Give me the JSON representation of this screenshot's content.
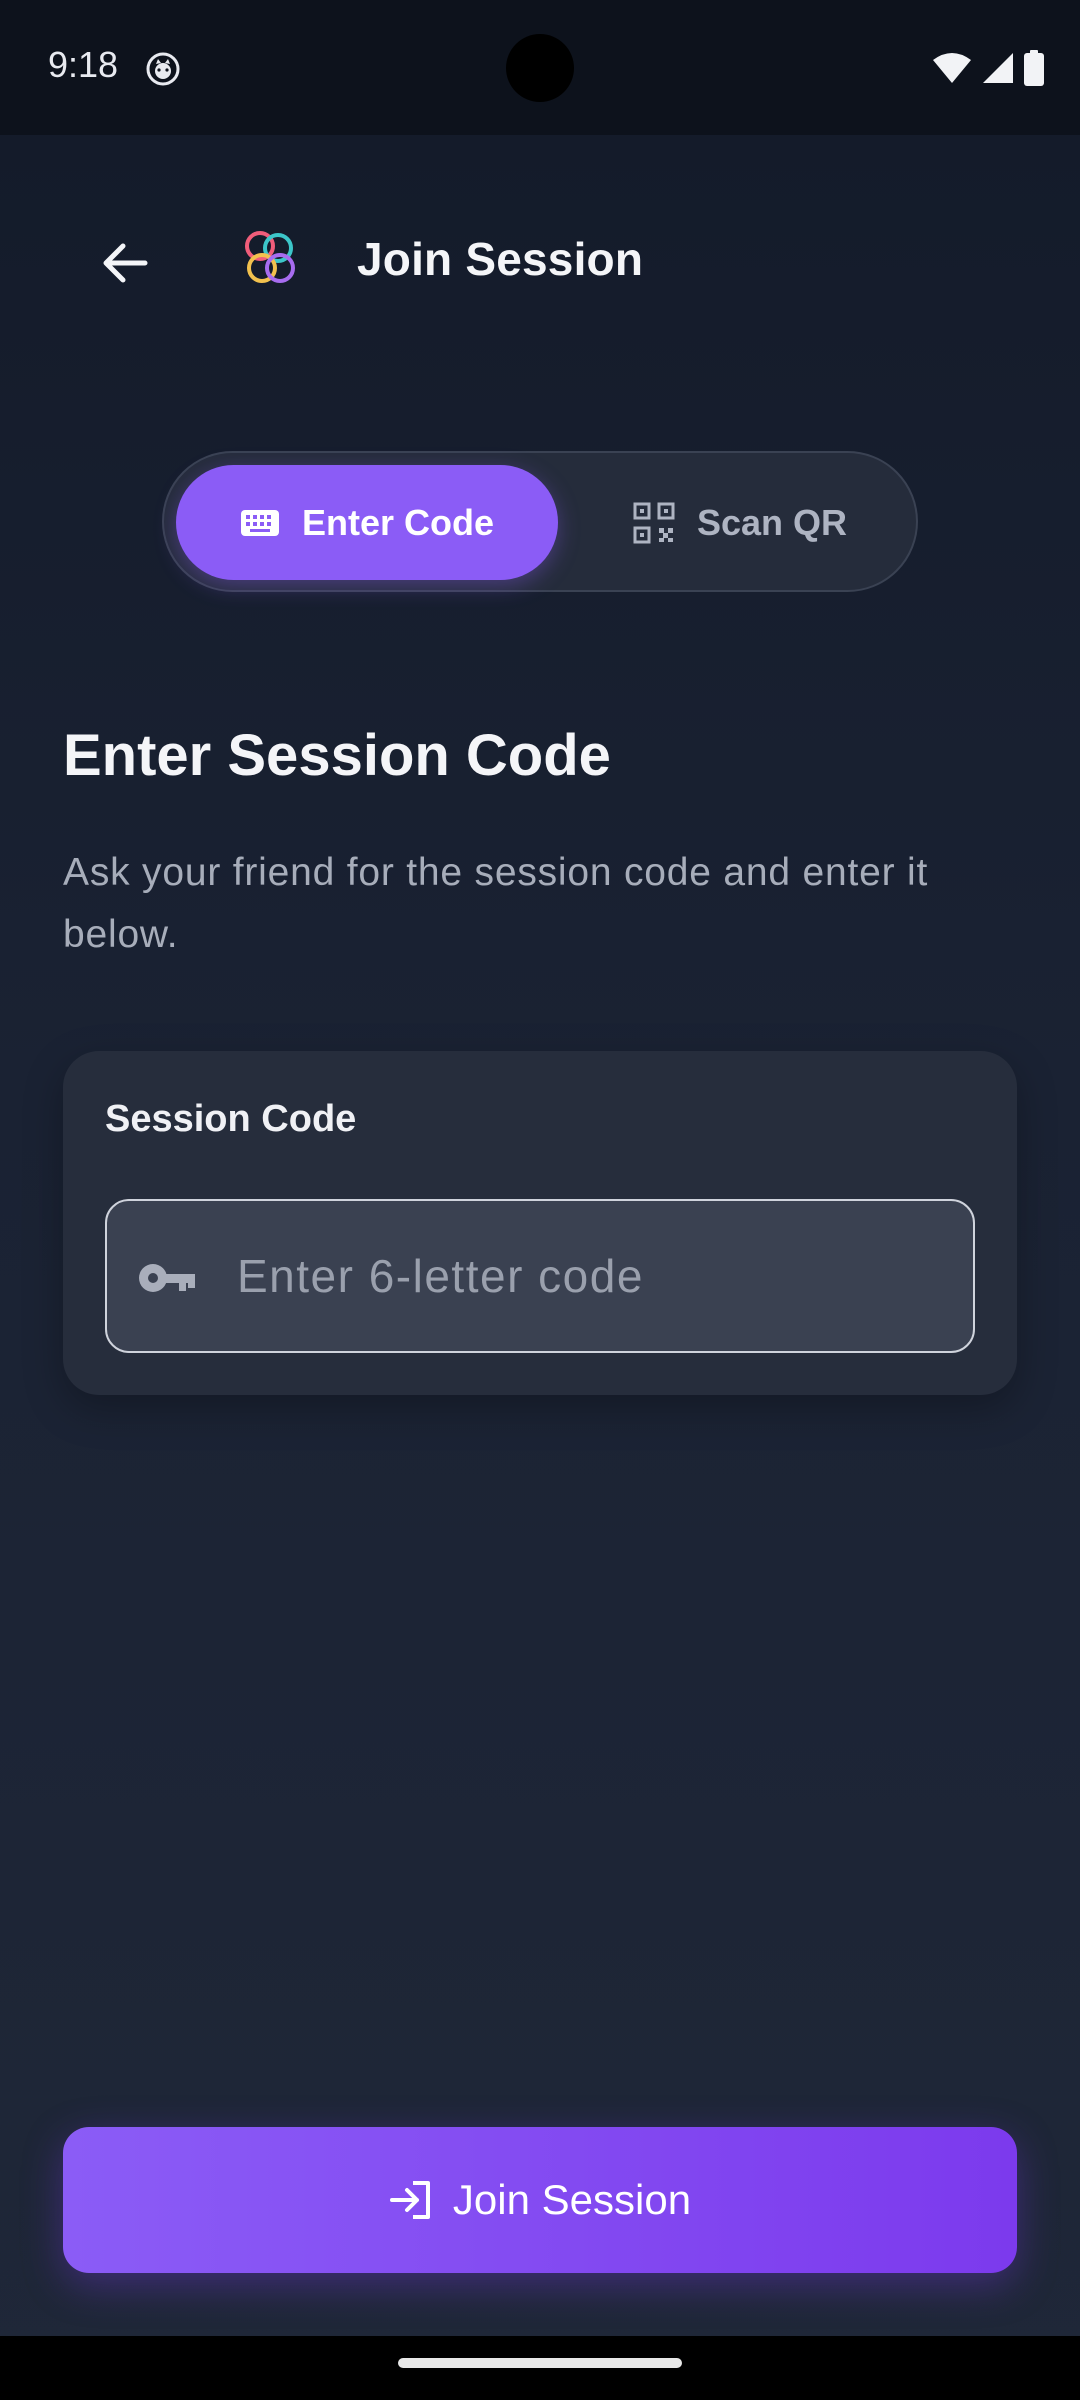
{
  "status_bar": {
    "time": "9:18"
  },
  "app_bar": {
    "title": "Join Session"
  },
  "mode_toggle": {
    "options": [
      {
        "label": "Enter Code",
        "icon": "keyboard-icon",
        "selected": true
      },
      {
        "label": "Scan QR",
        "icon": "qr-code-icon",
        "selected": false
      }
    ]
  },
  "content": {
    "heading": "Enter Session Code",
    "description": "Ask your friend for the session code and enter it below."
  },
  "code_card": {
    "label": "Session Code",
    "input_placeholder": "Enter 6-letter code",
    "input_value": "",
    "input_icon": "key-icon"
  },
  "primary_action": {
    "label": "Join Session",
    "icon": "login-icon"
  },
  "colors": {
    "accent": "#8b5cf6",
    "accent_dark": "#7c3aed",
    "background": "#1a2233",
    "card": "#262d3c"
  }
}
